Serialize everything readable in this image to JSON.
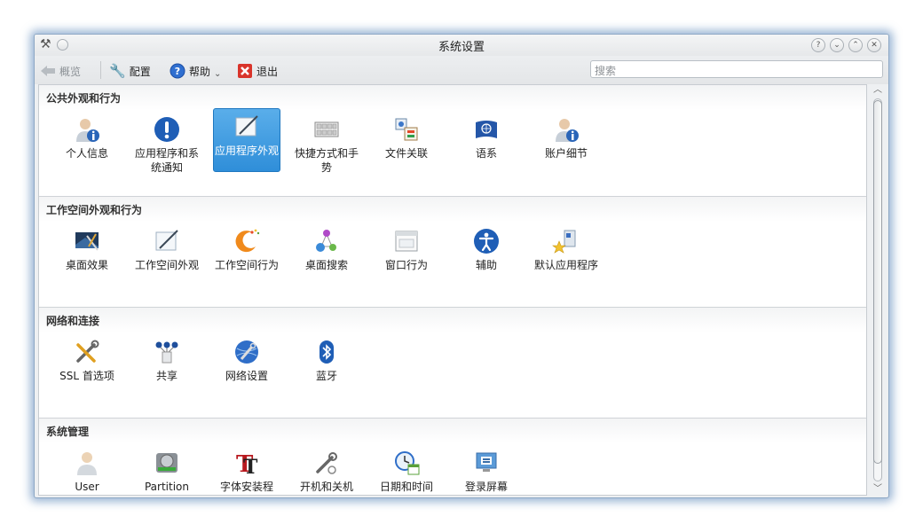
{
  "window": {
    "title": "系统设置"
  },
  "toolbar": {
    "overview_label": "概览",
    "configure_label": "配置",
    "help_label": "帮助",
    "quit_label": "退出",
    "search_placeholder": "搜索"
  },
  "sections": [
    {
      "title": "公共外观和行为",
      "items": [
        {
          "label": "个人信息",
          "icon": "user-info-icon"
        },
        {
          "label": "应用程序和系统通知",
          "icon": "notification-icon"
        },
        {
          "label": "应用程序外观",
          "icon": "app-appearance-icon",
          "selected": true
        },
        {
          "label": "快捷方式和手势",
          "icon": "keyboard-icon"
        },
        {
          "label": "文件关联",
          "icon": "file-association-icon"
        },
        {
          "label": "语系",
          "icon": "locale-icon"
        },
        {
          "label": "账户细节",
          "icon": "account-icon"
        }
      ]
    },
    {
      "title": "工作空间外观和行为",
      "items": [
        {
          "label": "桌面效果",
          "icon": "desktop-effects-icon"
        },
        {
          "label": "工作空间外观",
          "icon": "workspace-appearance-icon"
        },
        {
          "label": "工作空间行为",
          "icon": "workspace-behavior-icon"
        },
        {
          "label": "桌面搜索",
          "icon": "desktop-search-icon"
        },
        {
          "label": "窗口行为",
          "icon": "window-behavior-icon"
        },
        {
          "label": "辅助",
          "icon": "accessibility-icon"
        },
        {
          "label": "默认应用程序",
          "icon": "default-apps-icon"
        }
      ]
    },
    {
      "title": "网络和连接",
      "items": [
        {
          "label": "SSL 首选项",
          "icon": "ssl-icon"
        },
        {
          "label": "共享",
          "icon": "sharing-icon"
        },
        {
          "label": "网络设置",
          "icon": "network-icon"
        },
        {
          "label": "蓝牙",
          "icon": "bluetooth-icon"
        }
      ]
    },
    {
      "title": "系统管理",
      "items": [
        {
          "label": "User",
          "icon": "user-icon"
        },
        {
          "label": "Partition",
          "icon": "partition-icon"
        },
        {
          "label": "字体安装程",
          "icon": "font-installer-icon"
        },
        {
          "label": "开机和关机",
          "icon": "startup-shutdown-icon"
        },
        {
          "label": "日期和时间",
          "icon": "datetime-icon"
        },
        {
          "label": "登录屏幕",
          "icon": "login-screen-icon"
        }
      ]
    }
  ]
}
